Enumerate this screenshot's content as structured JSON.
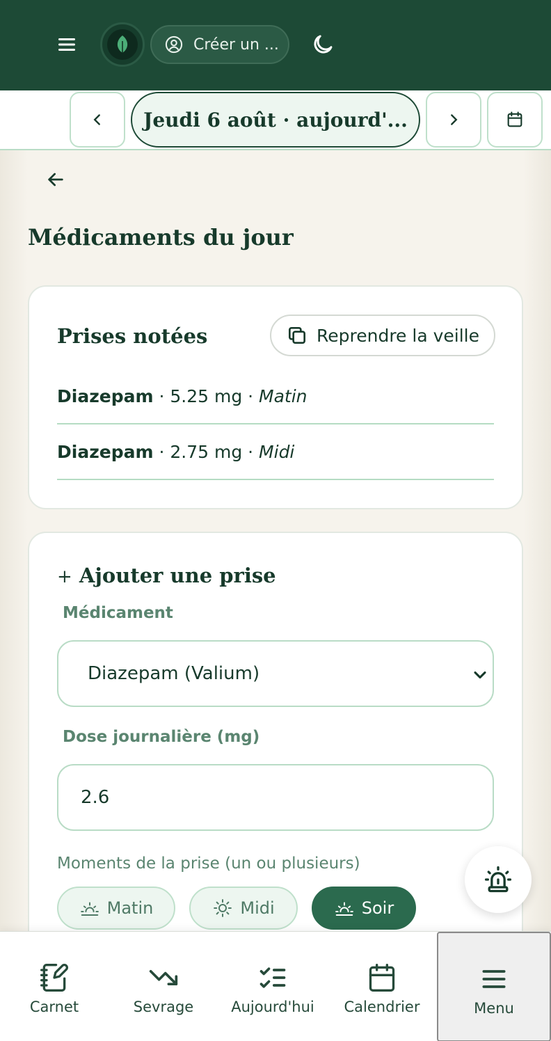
{
  "header": {
    "account_label": "Créer un ...",
    "icons": [
      "menu-icon",
      "leaf-logo",
      "user-circle-icon",
      "moon-icon"
    ]
  },
  "date_nav": {
    "current_date": "Jeudi 6 août · aujourd'..."
  },
  "page": {
    "title": "Médicaments du jour"
  },
  "taken": {
    "title": "Prises notées",
    "copy_button": "Reprendre la veille",
    "items": [
      {
        "name": "Diazepam",
        "dose": "5.25 mg",
        "moment": "Matin",
        "sep1": " · ",
        "sep2": " · "
      },
      {
        "name": "Diazepam",
        "dose": "2.75 mg",
        "moment": "Midi",
        "sep1": " · ",
        "sep2": " · "
      }
    ]
  },
  "add_form": {
    "plus": "+",
    "title": "Ajouter une prise",
    "medication_label": "Médicament",
    "medication_value": "Diazepam (Valium)",
    "dose_label": "Dose journalière (mg)",
    "dose_value": "2.6",
    "moments_label": "Moments de la prise (un ou plusieurs)",
    "moments": [
      {
        "label": "Matin",
        "selected": false
      },
      {
        "label": "Midi",
        "selected": false
      },
      {
        "label": "Soir",
        "selected": true
      }
    ]
  },
  "bottom_nav": {
    "items": [
      {
        "label": "Carnet",
        "icon": "notebook-pen-icon"
      },
      {
        "label": "Sevrage",
        "icon": "trending-down-icon"
      },
      {
        "label": "Aujourd'hui",
        "icon": "list-checks-icon"
      },
      {
        "label": "Calendrier",
        "icon": "calendar-icon"
      },
      {
        "label": "Menu",
        "icon": "menu-icon",
        "selected": true
      }
    ]
  },
  "colors": {
    "primary_dark": "#1d4a36",
    "accent": "#2b6a4e",
    "border_green": "#b9dcc6",
    "label_green": "#5a8570"
  }
}
